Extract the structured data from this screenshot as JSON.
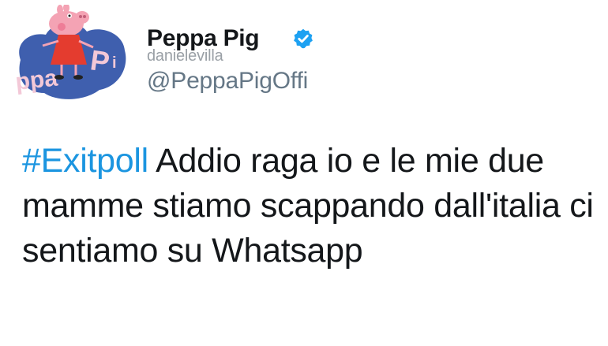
{
  "tweet": {
    "display_name": "Peppa Pig",
    "watermark": "danielevilla",
    "handle": "@PeppaPigOffi",
    "avatar_text": "Peppa Pig",
    "hashtag": "#Exitpoll",
    "text": " Addio raga io e le mie due mamme stiamo scappando dall'italia ci sentiamo su Whatsapp"
  },
  "colors": {
    "hashtag": "#1b95e0",
    "verified": "#1da1f2",
    "avatar_blob": "#3f5fae",
    "peppa_pink": "#f4a3b4",
    "peppa_dress": "#e43c2f"
  },
  "icons": {
    "verified": "verified-badge-icon",
    "avatar": "peppa-pig-logo"
  }
}
